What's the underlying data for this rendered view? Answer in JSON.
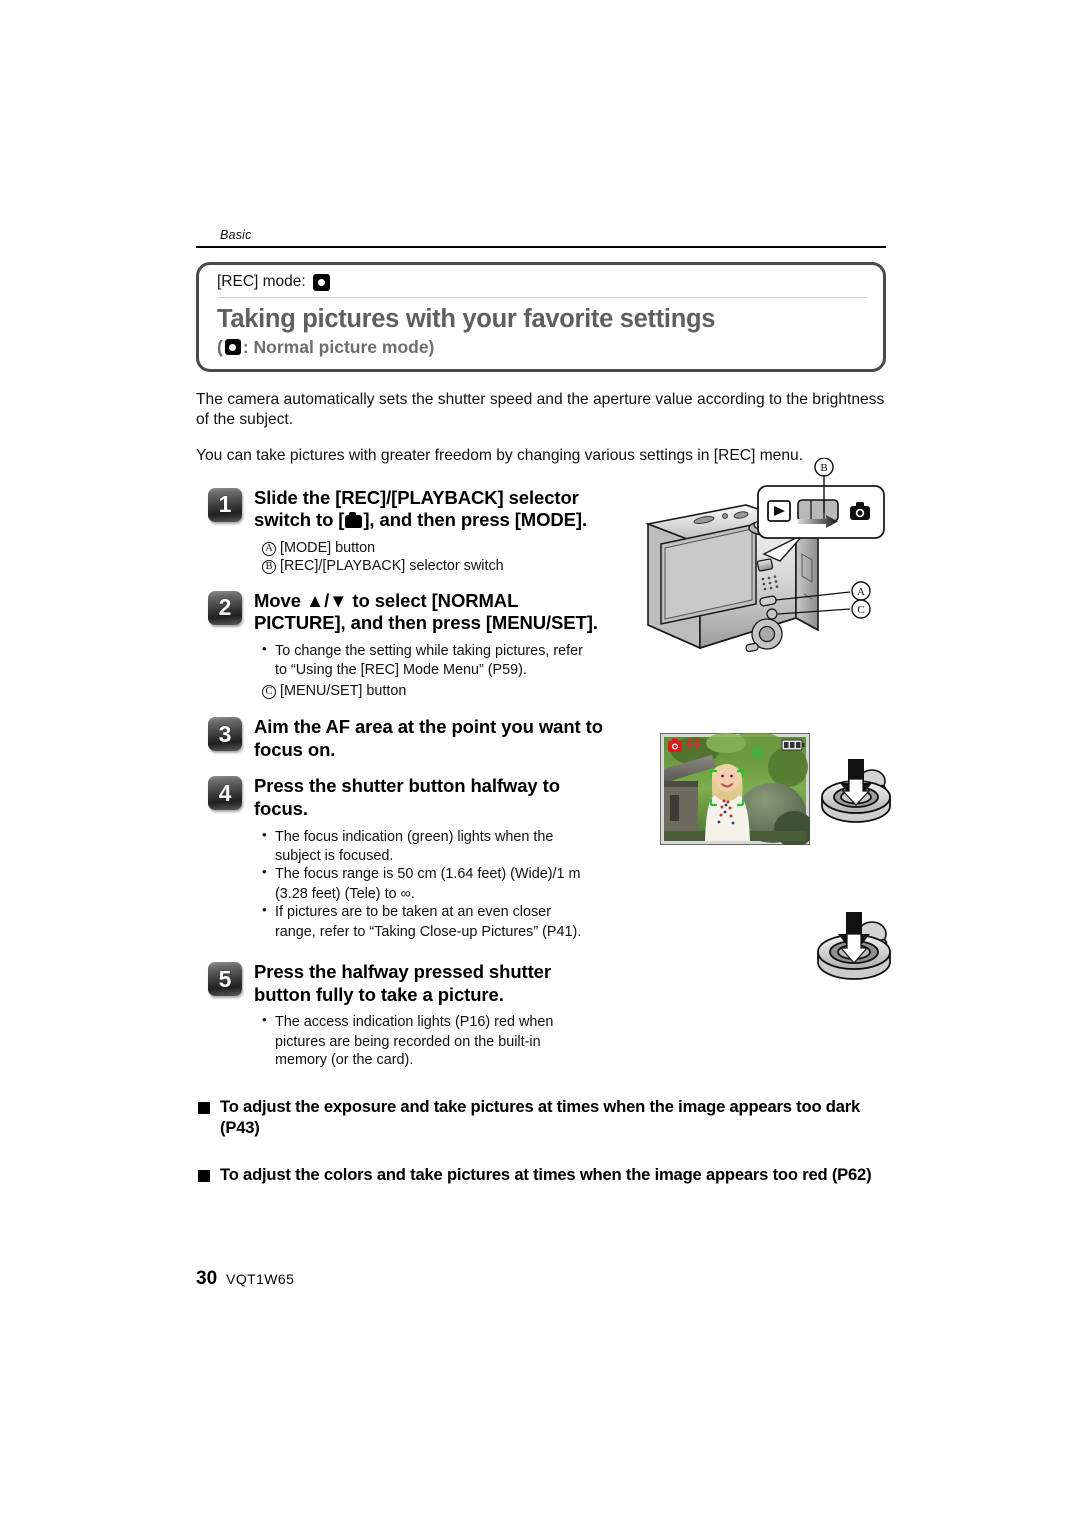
{
  "page": {
    "running_head": "Basic",
    "number": "30",
    "code": "VQT1W65"
  },
  "titlebox": {
    "rec_mode_label": "[REC] mode:",
    "rec_mode_icon": "normal-picture-mode-icon",
    "title": "Taking pictures with your favorite settings",
    "subtitle_prefix": "(",
    "subtitle_icon": "normal-picture-mode-icon",
    "subtitle": ": Normal picture mode)"
  },
  "intro": [
    "The camera automatically sets the shutter speed and the aperture value according to the brightness of the subject.",
    "You can take pictures with greater freedom by changing various settings in [REC] menu."
  ],
  "steps": [
    {
      "number": "1",
      "heading_line1": "Slide the [REC]/[PLAYBACK] selector",
      "heading_line2_pre": "switch to [",
      "heading_line2_post": "], and then press [MODE].",
      "notes": [
        {
          "marker": "A",
          "text": "[MODE] button"
        },
        {
          "marker": "B",
          "text": "[REC]/[PLAYBACK] selector switch"
        }
      ]
    },
    {
      "number": "2",
      "heading_line1": "Move ▲/▼ to select [NORMAL",
      "heading_line2": "PICTURE], and then press [MENU/SET].",
      "bullets": [
        "To change the setting while taking pictures, refer",
        "to “Using the [REC] Mode Menu”  (P59)."
      ],
      "notes": [
        {
          "marker": "C",
          "text": "[MENU/SET] button"
        }
      ]
    },
    {
      "number": "3",
      "heading_line1": "Aim the AF area at the point you want to",
      "heading_line2": "focus on."
    },
    {
      "number": "4",
      "heading_line1": "Press the shutter button halfway to",
      "heading_line2": "focus.",
      "bullets": [
        "The focus indication (green) lights when the",
        "subject is focused.",
        "The focus range is 50 cm (1.64 feet) (Wide)/1 m",
        "(3.28 feet) (Tele) to ∞.",
        "If pictures are to be taken at an even closer",
        "range, refer to “Taking Close-up Pictures” (P41)."
      ]
    },
    {
      "number": "5",
      "heading_line1": "Press the halfway pressed shutter",
      "heading_line2": "button fully to take a picture.",
      "bullets": [
        "The access indication lights (P16) red when",
        "pictures are being recorded on the built-in",
        "memory (or the card)."
      ]
    }
  ],
  "sections": [
    "To adjust the exposure and take pictures at times when the image appears too dark (P43)",
    "To adjust the colors and take pictures at times when the image appears too red (P62)"
  ],
  "illustrations": {
    "camera": {
      "name": "camera-rear-illustration",
      "callout_b": "B",
      "callout_a": "A",
      "callout_c": "C"
    },
    "lcd": {
      "name": "lcd-preview-illustration"
    },
    "shutter_half": {
      "name": "shutter-button-halfway-illustration"
    },
    "shutter_full": {
      "name": "shutter-button-full-illustration"
    }
  },
  "colors": {
    "title_gray": "#5f5f5f",
    "box_border": "#4a4a4a",
    "text_black": "#111111"
  }
}
